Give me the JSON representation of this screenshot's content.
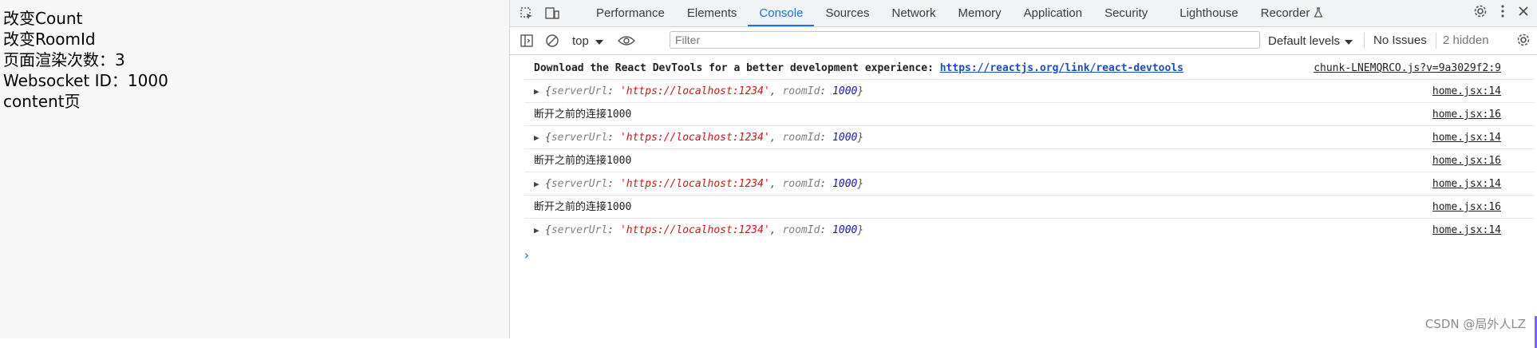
{
  "page": {
    "lines": [
      "改变Count",
      "改变RoomId",
      "页面渲染次数：3",
      "Websocket ID：1000",
      "content页"
    ]
  },
  "devtools": {
    "tabs": [
      "Performance",
      "Elements",
      "Console",
      "Sources",
      "Network",
      "Memory",
      "Application",
      "Security",
      "Lighthouse",
      "Recorder"
    ],
    "active_tab": "Console",
    "accent_color": "#1a73e8",
    "toolbar": {
      "context": "top",
      "filter_placeholder": "Filter",
      "levels": "Default levels",
      "issues": "No Issues",
      "hidden": "2 hidden"
    },
    "console": {
      "messages": [
        {
          "type": "info",
          "text": "Download the React DevTools for a better development experience: ",
          "link": "https://reactjs.org/link/react-devtools",
          "source": "chunk-LNEMQRCO.js?v=9a3029f2:9"
        },
        {
          "type": "object",
          "key1": "serverUrl",
          "value1": "'https://localhost:1234'",
          "key2": "roomId",
          "value2": "1000",
          "source": "home.jsx:14"
        },
        {
          "type": "log",
          "text": "断开之前的连接1000",
          "source": "home.jsx:16"
        },
        {
          "type": "object",
          "key1": "serverUrl",
          "value1": "'https://localhost:1234'",
          "key2": "roomId",
          "value2": "1000",
          "source": "home.jsx:14"
        },
        {
          "type": "log",
          "text": "断开之前的连接1000",
          "source": "home.jsx:16"
        },
        {
          "type": "object",
          "key1": "serverUrl",
          "value1": "'https://localhost:1234'",
          "key2": "roomId",
          "value2": "1000",
          "source": "home.jsx:14"
        },
        {
          "type": "log",
          "text": "断开之前的连接1000",
          "source": "home.jsx:16"
        },
        {
          "type": "object",
          "key1": "serverUrl",
          "value1": "'https://localhost:1234'",
          "key2": "roomId",
          "value2": "1000",
          "source": "home.jsx:14"
        }
      ]
    }
  },
  "watermark": "CSDN @局外人LZ"
}
